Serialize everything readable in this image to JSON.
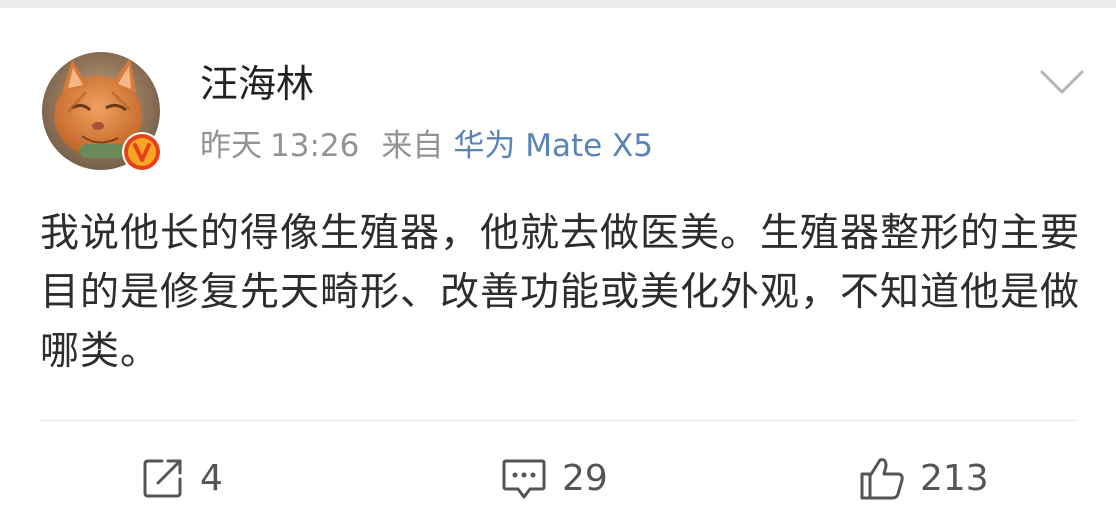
{
  "post": {
    "author": {
      "name": "汪海林",
      "verified_badge": "V"
    },
    "meta": {
      "day": "昨天",
      "time": "13:26",
      "from_label": "来自",
      "device": "华为 Mate X5"
    },
    "content": "我说他长的得像生殖器，他就去做医美。生殖器整形的主要目的是修复先天畸形、改善功能或美化外观，不知道他是做哪类。",
    "actions": {
      "repost_count": "4",
      "comment_count": "29",
      "like_count": "213"
    }
  },
  "icons": {
    "menu": "chevron-down-icon",
    "repost": "repost-icon",
    "comment": "comment-icon",
    "like": "thumbs-up-icon"
  },
  "colors": {
    "device_link": "#5a83b8",
    "verified_badge": "#f5a623",
    "verified_badge_border": "#e8401c",
    "meta_text": "#939393"
  }
}
